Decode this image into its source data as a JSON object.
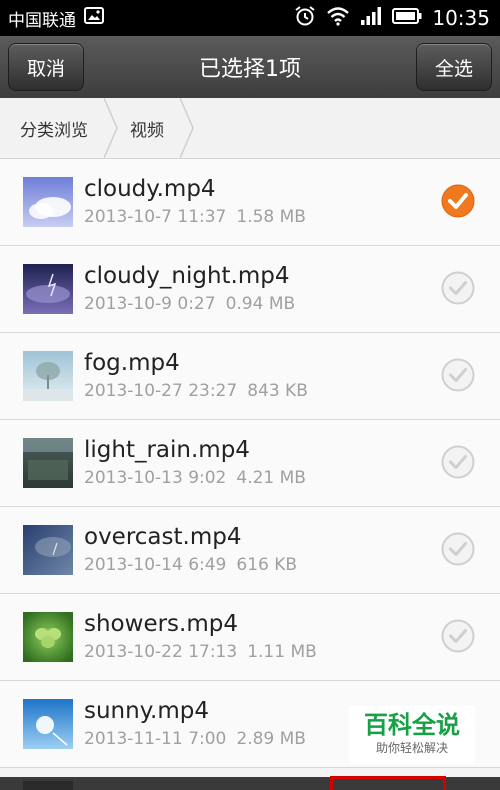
{
  "status_bar": {
    "carrier": "中国联通",
    "time": "10:35",
    "icons": [
      "image-icon",
      "alarm-icon",
      "wifi-icon",
      "signal-icon",
      "battery-icon"
    ]
  },
  "header": {
    "cancel_label": "取消",
    "title": "已选择1项",
    "select_all_label": "全选"
  },
  "breadcrumb": {
    "items": [
      "分类浏览",
      "视频"
    ]
  },
  "files": [
    {
      "name": "cloudy.mp4",
      "date": "2013-10-7 11:37",
      "size": "1.58 MB",
      "selected": true
    },
    {
      "name": "cloudy_night.mp4",
      "date": "2013-10-9 0:27",
      "size": "0.94 MB",
      "selected": false
    },
    {
      "name": "fog.mp4",
      "date": "2013-10-27 23:27",
      "size": "843 KB",
      "selected": false
    },
    {
      "name": "light_rain.mp4",
      "date": "2013-10-13 9:02",
      "size": "4.21 MB",
      "selected": false
    },
    {
      "name": "overcast.mp4",
      "date": "2013-10-14 6:49",
      "size": "616 KB",
      "selected": false
    },
    {
      "name": "showers.mp4",
      "date": "2013-10-22 17:13",
      "size": "1.11 MB",
      "selected": false
    },
    {
      "name": "sunny.mp4",
      "date": "2013-11-11 7:00",
      "size": "2.89 MB",
      "selected": false
    }
  ],
  "watermark": {
    "title": "百科全说",
    "subtitle": "助你轻松解决"
  },
  "colors": {
    "accent_orange": "#f0781e",
    "highlight_red": "#d40000",
    "watermark_green": "#17a046"
  }
}
